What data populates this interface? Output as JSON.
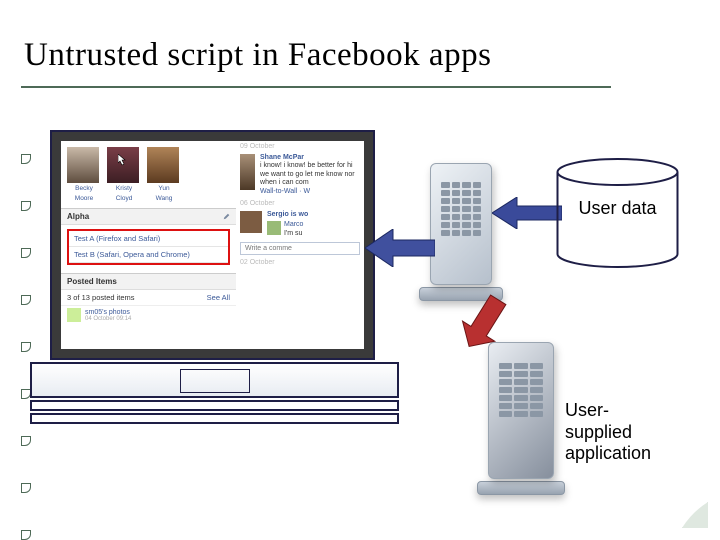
{
  "title": "Untrusted script in Facebook apps",
  "labels": {
    "user_data": "User data",
    "user_app_l1": "User-",
    "user_app_l2": "supplied",
    "user_app_l3": "application"
  },
  "fb": {
    "friends": [
      {
        "first": "Becky",
        "last": "Moore"
      },
      {
        "first": "Kristy",
        "last": "Cloyd"
      },
      {
        "first": "Yun",
        "last": "Wang"
      }
    ],
    "alpha_header": "Alpha",
    "alpha_lines": [
      "Test A (Firefox and Safari)",
      "Test B (Safari, Opera and Chrome)"
    ],
    "posted_header": "Posted Items",
    "posted_count": "3 of 13 posted items",
    "see_all": "See All",
    "photos_title": "sm05's photos",
    "photos_date": "04 October 09:14",
    "dates": [
      "09 October",
      "06 October",
      "02 October"
    ],
    "story1_name": "Shane McPar",
    "story1_text": "i know! i know! be better for hi we want to go let me know nor when i can com",
    "story1_link": "Wall-to-Wall · W",
    "story2_name": "Sergio is wo",
    "story2_sub1": "Marco",
    "story2_sub2": "I'm su",
    "comment_placeholder": "Write a comme"
  }
}
